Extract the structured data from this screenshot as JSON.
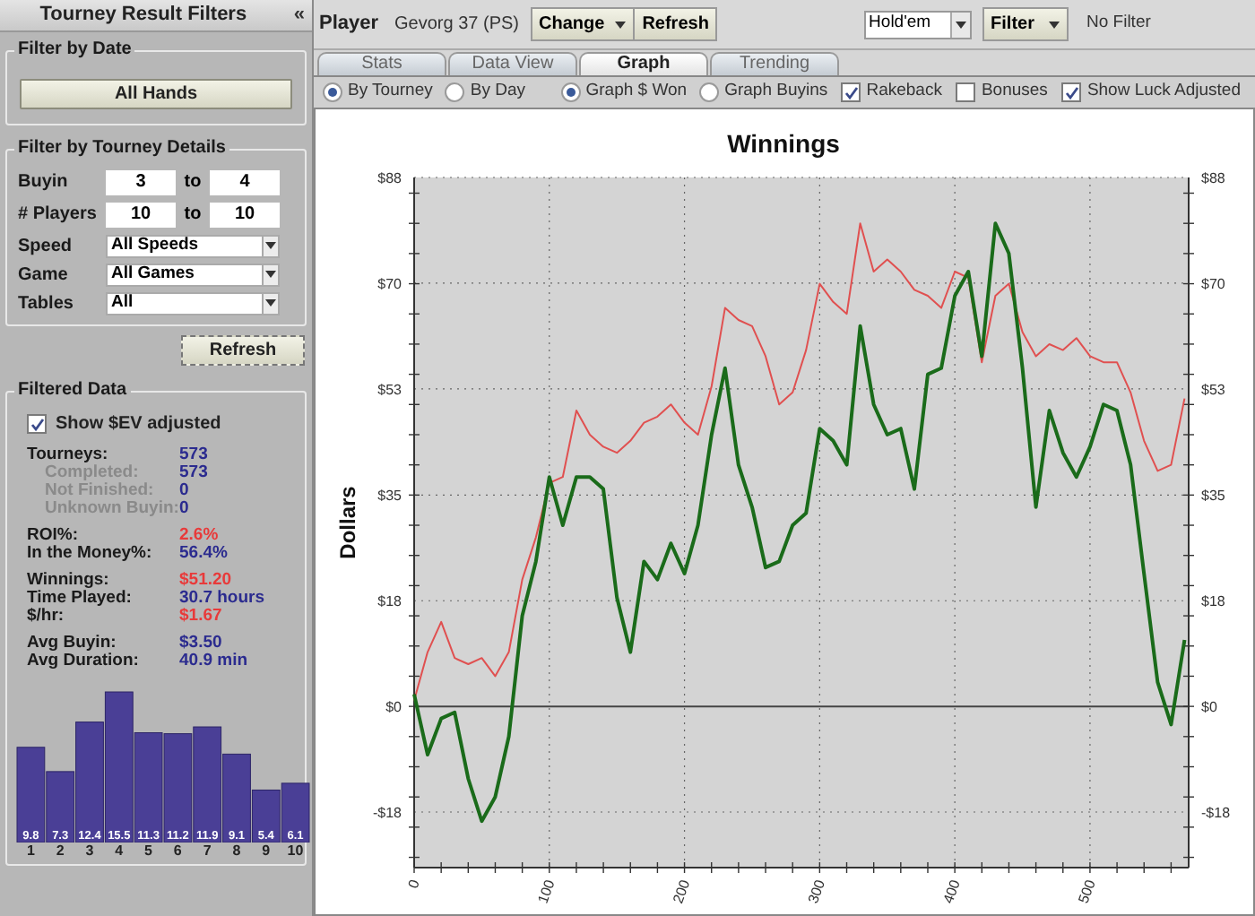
{
  "sidebar": {
    "title": "Tourney Result Filters",
    "collapse": "«",
    "date_filter": {
      "legend": "Filter by Date",
      "button": "All Hands"
    },
    "details_filter": {
      "legend": "Filter by Tourney Details",
      "ranges": [
        {
          "label": "Buyin",
          "from": "3",
          "separator": "to",
          "to": "4"
        },
        {
          "label": "# Players",
          "from": "10",
          "separator": "to",
          "to": "10"
        }
      ],
      "selects": [
        {
          "label": "Speed",
          "value": "All Speeds"
        },
        {
          "label": "Game",
          "value": "All Games"
        },
        {
          "label": "Tables",
          "value": "All"
        }
      ]
    },
    "refresh_button": "Refresh",
    "filtered_data": {
      "legend": "Filtered Data",
      "ev_checkbox": {
        "label": "Show $EV adjusted",
        "checked": true
      },
      "groups": [
        [
          {
            "label": "Tourneys:",
            "value": "573",
            "kind": "main",
            "color": "#2b2b8f"
          },
          {
            "label": "Completed:",
            "value": "573",
            "kind": "sub",
            "color": "#2b2b8f"
          },
          {
            "label": "Not Finished:",
            "value": "0",
            "kind": "sub",
            "color": "#2b2b8f"
          },
          {
            "label": "Unknown Buyin:",
            "value": "0",
            "kind": "sub",
            "color": "#2b2b8f"
          }
        ],
        [
          {
            "label": "ROI%:",
            "value": "2.6%",
            "kind": "main",
            "color": "#e83a3a"
          },
          {
            "label": "In the Money%:",
            "value": "56.4%",
            "kind": "main",
            "color": "#2b2b8f"
          }
        ],
        [
          {
            "label": "Winnings:",
            "value": "$51.20",
            "kind": "main",
            "color": "#e83a3a"
          },
          {
            "label": "Time Played:",
            "value": "30.7 hours",
            "kind": "main",
            "color": "#2b2b8f"
          },
          {
            "label": "$/hr:",
            "value": "$1.67",
            "kind": "main",
            "color": "#e83a3a"
          }
        ],
        [
          {
            "label": "Avg Buyin:",
            "value": "$3.50",
            "kind": "main",
            "color": "#2b2b8f"
          },
          {
            "label": "Avg Duration:",
            "value": "40.9 min",
            "kind": "main",
            "color": "#2b2b8f"
          }
        ]
      ],
      "chart_data": {
        "type": "bar",
        "categories": [
          "1",
          "2",
          "3",
          "4",
          "5",
          "6",
          "7",
          "8",
          "9",
          "10"
        ],
        "series": [
          {
            "color": "#4a3f96",
            "values": [
              9.8,
              7.3,
              12.4,
              15.5,
              11.3,
              11.2,
              11.9,
              9.1,
              5.4,
              6.1
            ]
          }
        ],
        "data_labels": true
      }
    }
  },
  "toolbar": {
    "label": "Player",
    "player": "Gevorg 37 (PS)",
    "change_button": "Change",
    "refresh_button": "Refresh",
    "game_select": "Hold'em",
    "filter_button": "Filter",
    "filter_status": "No Filter"
  },
  "tabs": [
    {
      "label": "Stats",
      "selected": false
    },
    {
      "label": "Data View",
      "selected": false
    },
    {
      "label": "Graph",
      "selected": true
    },
    {
      "label": "Trending",
      "selected": false
    }
  ],
  "options": {
    "radio_groups": [
      [
        {
          "label": "By Tourney",
          "selected": true
        },
        {
          "label": "By Day",
          "selected": false
        }
      ],
      [
        {
          "label": "Graph $ Won",
          "selected": true
        },
        {
          "label": "Graph Buyins",
          "selected": false
        }
      ]
    ],
    "checkboxes": [
      {
        "label": "Rakeback",
        "checked": true
      },
      {
        "label": "Bonuses",
        "checked": false
      },
      {
        "label": "Show Luck Adjusted",
        "checked": true
      }
    ]
  },
  "chart_data": {
    "type": "line",
    "title": "Winnings",
    "ylabel": "Dollars",
    "xlim": [
      0,
      573
    ],
    "ylim": [
      -26.7,
      87.6
    ],
    "grid": true,
    "xticks": [
      0,
      100,
      200,
      300,
      400,
      500
    ],
    "yticks": [
      {
        "value": 87.6,
        "label": "$88"
      },
      {
        "value": 70.1,
        "label": "$70"
      },
      {
        "value": 52.6,
        "label": "$53"
      },
      {
        "value": 35,
        "label": "$35"
      },
      {
        "value": 17.5,
        "label": "$18"
      },
      {
        "value": 0,
        "label": "$0"
      },
      {
        "value": -17.5,
        "label": "-$18"
      }
    ],
    "x": [
      0,
      10,
      20,
      30,
      40,
      50,
      60,
      70,
      80,
      90,
      100,
      110,
      120,
      130,
      140,
      150,
      160,
      170,
      180,
      190,
      200,
      210,
      220,
      230,
      240,
      250,
      260,
      270,
      280,
      290,
      300,
      310,
      320,
      330,
      340,
      350,
      360,
      370,
      380,
      390,
      400,
      410,
      420,
      430,
      440,
      450,
      460,
      470,
      480,
      490,
      500,
      510,
      520,
      530,
      540,
      550,
      560,
      570
    ],
    "series": [
      {
        "color": "#e05050",
        "values": [
          1,
          9,
          14,
          8,
          7,
          8,
          5,
          9,
          21,
          28,
          37,
          38,
          49,
          45,
          43,
          42,
          44,
          47,
          48,
          50,
          47,
          45,
          53,
          66,
          64,
          63,
          58,
          50,
          52,
          59,
          70,
          67,
          65,
          80,
          72,
          74,
          72,
          69,
          68,
          66,
          72,
          71,
          57,
          68,
          70,
          62,
          58,
          60,
          59,
          61,
          58,
          57,
          57,
          52,
          44,
          39,
          40,
          51
        ]
      },
      {
        "color": "#1a6b1a",
        "values": [
          2,
          -8,
          -2,
          -1,
          -12,
          -19,
          -15,
          -5,
          15,
          24,
          38,
          30,
          38,
          38,
          36,
          18,
          9,
          24,
          21,
          27,
          22,
          30,
          45,
          56,
          40,
          33,
          23,
          24,
          30,
          32,
          46,
          44,
          40,
          63,
          50,
          45,
          46,
          36,
          55,
          56,
          68,
          72,
          58,
          80,
          75,
          56,
          33,
          49,
          42,
          38,
          43,
          50,
          49,
          40,
          22,
          4,
          -3,
          11
        ]
      }
    ]
  }
}
